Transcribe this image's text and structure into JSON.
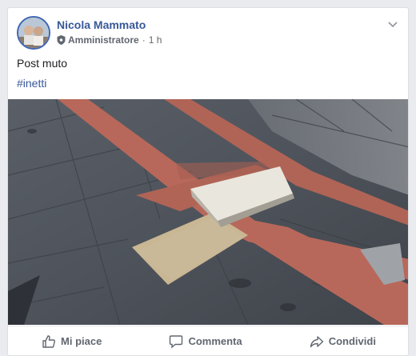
{
  "post": {
    "author": "Nicola Mammato",
    "role": "Amministratore",
    "separator": "·",
    "time": "1 h",
    "text": "Post muto",
    "hashtag": "#inetti"
  },
  "actions": {
    "like": "Mi piace",
    "comment": "Commenta",
    "share": "Condividi"
  },
  "colors": {
    "link": "#385898",
    "action_text": "#606770",
    "stripe_red": "#b8685a"
  },
  "icons": {
    "options": "chevron-down-icon",
    "role": "shield-icon",
    "like": "thumbs-up-icon",
    "comment": "comment-bubble-icon",
    "share": "share-arrow-icon"
  }
}
